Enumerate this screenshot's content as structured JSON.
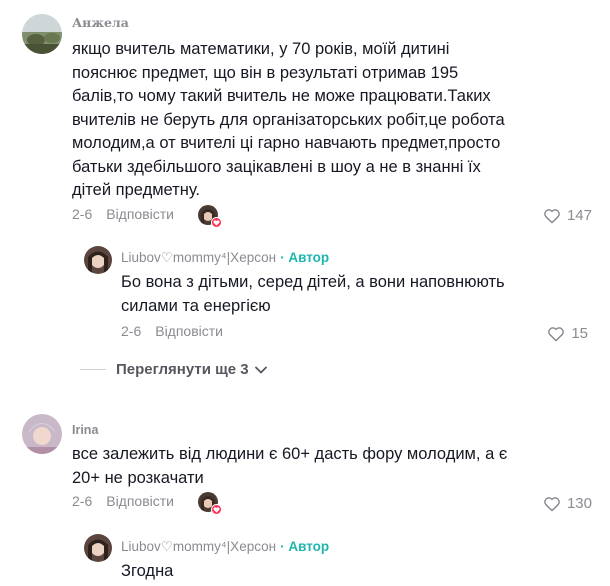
{
  "comments": [
    {
      "username": "Анжела",
      "text": "якщо вчитель математики, у 70 років, моїй дитині пояснює предмет, що він в результаті отримав 195 балів,то чому такий вчитель не може працювати.Таких вчителів не беруть для організаторських робіт,це робота молодим,а от вчителі ці гарно навчають предмет,просто батьки здебільшого зацікавлені в шоу а не в знанні їх дітей предметну.",
      "date": "2-6",
      "reply_label": "Відповісти",
      "likes": "147",
      "reply": {
        "username": "Liubov♡mommy⁴|Херсон",
        "author_label": "Автор",
        "text": "Бо вона з дітьми, серед дітей, а вони наповнюють силами та енергією",
        "date": "2-6",
        "reply_label": "Відповісти",
        "likes": "15"
      },
      "view_more_label": "Переглянути ще 3"
    },
    {
      "username": "Irina",
      "text": "все залежить від людини є 60+ дасть фору молодим, а є 20+ не розкачати",
      "date": "2-6",
      "reply_label": "Відповісти",
      "likes": "130",
      "reply": {
        "username": "Liubov♡mommy⁴|Херсон",
        "author_label": "Автор",
        "text": "Згодна"
      }
    }
  ],
  "colors": {
    "text": "#161823",
    "secondary": "#8a8b91",
    "author": "#1fb5ad",
    "heart_badge": "#fe2c55"
  },
  "icons": {
    "like": "heart-outline-icon",
    "expand": "chevron-down-icon",
    "creator_liked": "heart-badge-icon"
  }
}
